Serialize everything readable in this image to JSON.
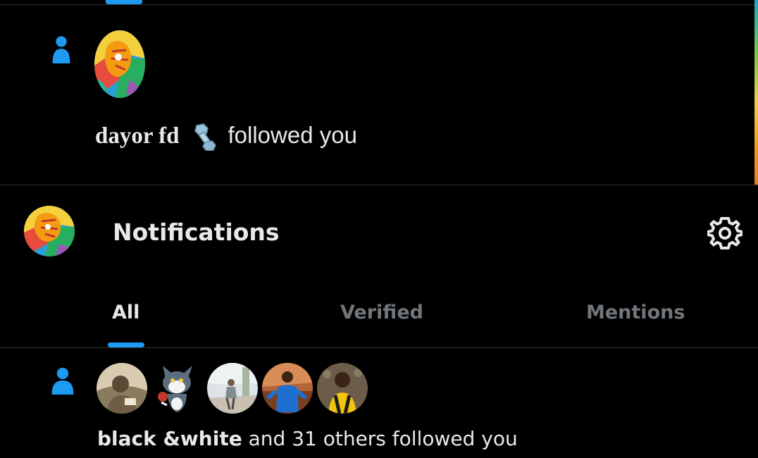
{
  "colors": {
    "background": "#000000",
    "accent": "#1d9bf0",
    "text_primary": "#e7e9ea",
    "text_secondary": "#71767b",
    "divider": "#2f3336"
  },
  "first_notification": {
    "icon": "person-icon",
    "avatar": "colorful-avatar",
    "name": "dayor fd",
    "emoji": "nut-and-bolt-emoji",
    "action": "followed you"
  },
  "header": {
    "avatar": "profile-avatar",
    "title": "Notifications",
    "settings_icon": "gear-icon"
  },
  "tabs": [
    {
      "label": "All",
      "active": true
    },
    {
      "label": "Verified",
      "active": false
    },
    {
      "label": "Mentions",
      "active": false
    }
  ],
  "second_notification": {
    "icon": "person-icon",
    "avatars": [
      "sepia-portrait-avatar",
      "cartoon-cat-avatar",
      "outdoor-photo-avatar",
      "blue-shirt-avatar",
      "football-jersey-avatar"
    ],
    "name": "black &white",
    "action": "and 31 others followed you"
  }
}
